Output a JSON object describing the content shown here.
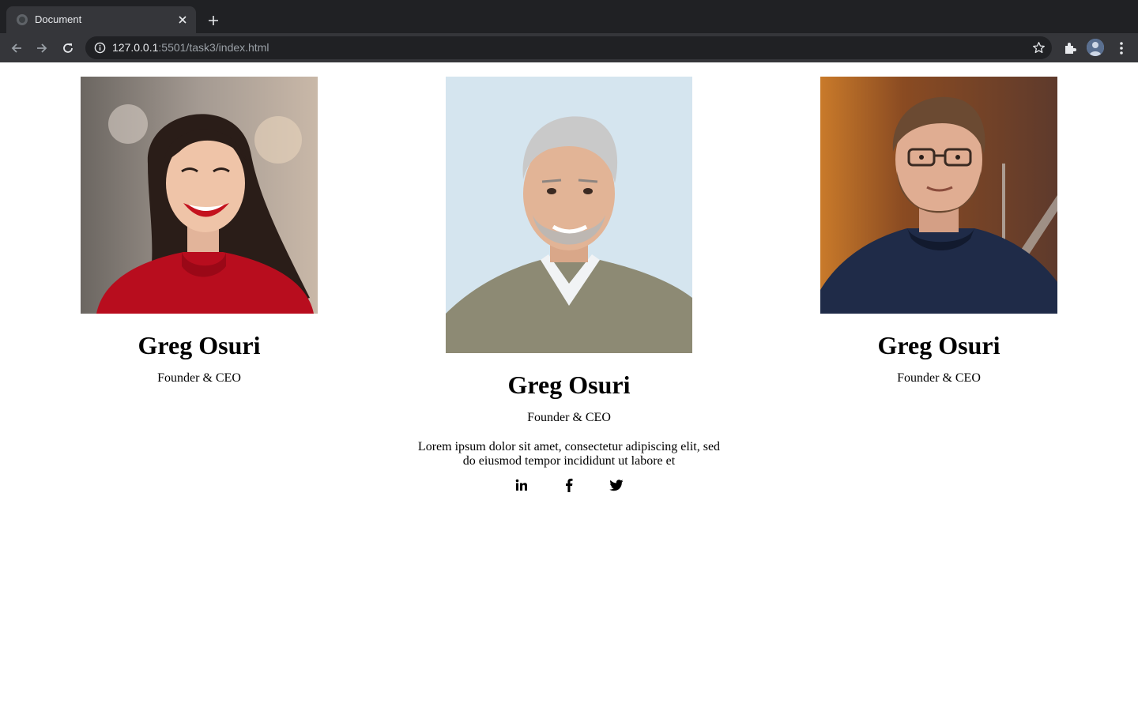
{
  "browser": {
    "tab_title": "Document",
    "url_host": "127.0.0.1",
    "url_rest": ":5501/task3/index.html"
  },
  "team": [
    {
      "name": "Greg Osuri",
      "role": "Founder & CEO",
      "photo": "woman-red-sweater-portrait"
    },
    {
      "name": "Greg Osuri",
      "role": "Founder & CEO",
      "photo": "grey-haired-man-portrait",
      "bio": "Lorem ipsum dolor sit amet, consectetur adipiscing elit, sed do eiusmod tempor incididunt ut labore et",
      "socials": [
        "linkedin-icon",
        "facebook-icon",
        "twitter-icon"
      ]
    },
    {
      "name": "Greg Osuri",
      "role": "Founder & CEO",
      "photo": "bearded-man-glasses-portrait"
    }
  ],
  "colors": {
    "chrome_dark": "#202124",
    "chrome_toolbar": "#35363a",
    "accent_sweater": "#b80d1e",
    "navy_sweater": "#1f2b48"
  }
}
